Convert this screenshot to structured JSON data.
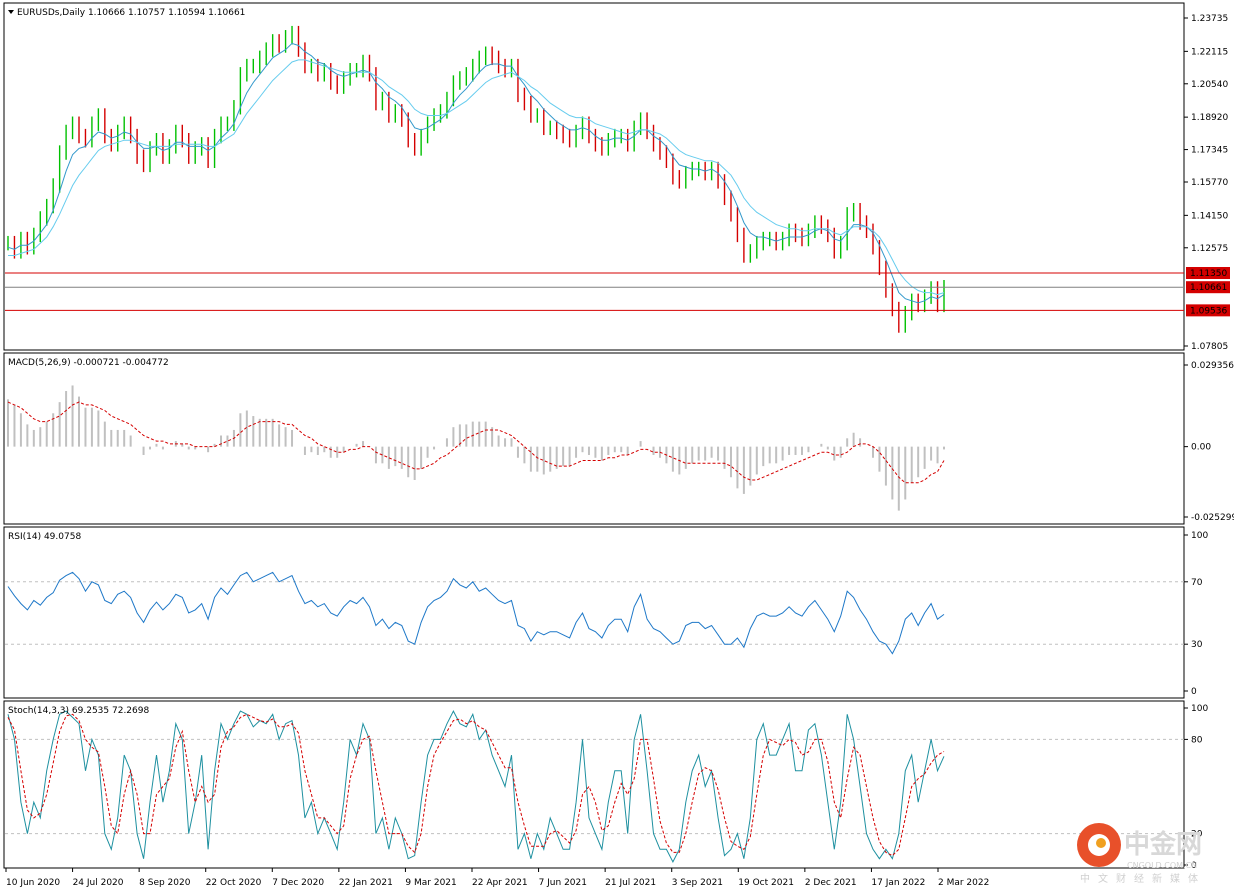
{
  "chart_data": {
    "type": "line",
    "main": {
      "header": "EURUSDs,Daily  1.10666 1.10757 1.10594 1.10661",
      "ylim": [
        1.07805,
        1.23735
      ],
      "yticks": [
        1.23735,
        1.22115,
        1.2054,
        1.1892,
        1.17345,
        1.1577,
        1.1415,
        1.12575,
        1.07805
      ],
      "ytick_labels": [
        "1.23735",
        "1.22115",
        "1.20540",
        "1.18920",
        "1.17345",
        "1.15770",
        "1.14150",
        "1.12575",
        "1.07805"
      ],
      "hlines": [
        {
          "value": 1.1135,
          "label": "1.11350",
          "color": "#d40000"
        },
        {
          "value": 1.09536,
          "label": "1.09536",
          "color": "#d40000"
        },
        {
          "value": 1.10661,
          "label": "1.10661",
          "color": "#808080"
        }
      ],
      "x_dates": [
        "10 Jun 2020",
        "24 Jul 2020",
        "8 Sep 2020",
        "22 Oct 2020",
        "7 Dec 2020",
        "22 Jan 2021",
        "9 Mar 2021",
        "22 Apr 2021",
        "7 Jun 2021",
        "21 Jul 2021",
        "3 Sep 2021",
        "19 Oct 2021",
        "2 Dec 2021",
        "17 Jan 2022",
        "2 Mar 2022"
      ],
      "close": [
        1.128,
        1.124,
        1.13,
        1.126,
        1.132,
        1.14,
        1.146,
        1.156,
        1.172,
        1.182,
        1.186,
        1.18,
        1.178,
        1.186,
        1.19,
        1.18,
        1.176,
        1.182,
        1.186,
        1.18,
        1.17,
        1.166,
        1.174,
        1.178,
        1.17,
        1.175,
        1.182,
        1.178,
        1.17,
        1.174,
        1.176,
        1.168,
        1.18,
        1.186,
        1.186,
        1.194,
        1.21,
        1.214,
        1.214,
        1.218,
        1.222,
        1.226,
        1.224,
        1.228,
        1.23,
        1.222,
        1.214,
        1.214,
        1.21,
        1.212,
        1.206,
        1.204,
        1.208,
        1.212,
        1.212,
        1.216,
        1.21,
        1.196,
        1.198,
        1.19,
        1.192,
        1.188,
        1.178,
        1.174,
        1.18,
        1.186,
        1.19,
        1.192,
        1.198,
        1.206,
        1.208,
        1.21,
        1.214,
        1.218,
        1.22,
        1.218,
        1.214,
        1.212,
        1.214,
        1.2,
        1.196,
        1.19,
        1.19,
        1.184,
        1.184,
        1.182,
        1.18,
        1.178,
        1.182,
        1.186,
        1.18,
        1.176,
        1.174,
        1.178,
        1.18,
        1.18,
        1.176,
        1.184,
        1.188,
        1.182,
        1.176,
        1.172,
        1.168,
        1.16,
        1.158,
        1.162,
        1.164,
        1.164,
        1.162,
        1.164,
        1.158,
        1.15,
        1.142,
        1.132,
        1.122,
        1.124,
        1.128,
        1.13,
        1.13,
        1.128,
        1.13,
        1.134,
        1.132,
        1.13,
        1.134,
        1.138,
        1.136,
        1.132,
        1.124,
        1.128,
        1.142,
        1.144,
        1.138,
        1.134,
        1.126,
        1.116,
        1.105,
        1.096,
        1.088,
        1.094,
        1.1,
        1.098,
        1.102,
        1.106,
        1.098,
        1.10661
      ],
      "ema_fast": [
        1.126,
        1.125,
        1.127,
        1.127,
        1.129,
        1.133,
        1.137,
        1.144,
        1.153,
        1.163,
        1.171,
        1.174,
        1.175,
        1.179,
        1.182,
        1.181,
        1.179,
        1.18,
        1.182,
        1.181,
        1.177,
        1.174,
        1.174,
        1.175,
        1.173,
        1.174,
        1.177,
        1.177,
        1.175,
        1.175,
        1.175,
        1.173,
        1.175,
        1.179,
        1.182,
        1.186,
        1.194,
        1.201,
        1.206,
        1.21,
        1.214,
        1.218,
        1.22,
        1.222,
        1.225,
        1.224,
        1.221,
        1.219,
        1.216,
        1.215,
        1.212,
        1.21,
        1.209,
        1.21,
        1.211,
        1.212,
        1.211,
        1.206,
        1.203,
        1.199,
        1.197,
        1.194,
        1.189,
        1.184,
        1.183,
        1.184,
        1.186,
        1.188,
        1.191,
        1.196,
        1.2,
        1.203,
        1.207,
        1.211,
        1.214,
        1.215,
        1.215,
        1.214,
        1.214,
        1.209,
        1.205,
        1.2,
        1.197,
        1.193,
        1.19,
        1.187,
        1.185,
        1.183,
        1.183,
        1.184,
        1.183,
        1.18,
        1.178,
        1.178,
        1.179,
        1.179,
        1.178,
        1.18,
        1.183,
        1.183,
        1.18,
        1.178,
        1.175,
        1.17,
        1.166,
        1.165,
        1.164,
        1.164,
        1.163,
        1.164,
        1.162,
        1.158,
        1.153,
        1.146,
        1.138,
        1.133,
        1.131,
        1.131,
        1.13,
        1.129,
        1.13,
        1.131,
        1.131,
        1.131,
        1.132,
        1.134,
        1.135,
        1.134,
        1.13,
        1.129,
        1.133,
        1.137,
        1.137,
        1.136,
        1.133,
        1.127,
        1.12,
        1.112,
        1.104,
        1.101,
        1.1,
        1.099,
        1.1,
        1.102,
        1.101,
        1.103
      ],
      "ema_slow": [
        1.122,
        1.122,
        1.123,
        1.124,
        1.125,
        1.128,
        1.131,
        1.136,
        1.142,
        1.149,
        1.156,
        1.161,
        1.165,
        1.169,
        1.173,
        1.175,
        1.176,
        1.177,
        1.178,
        1.178,
        1.177,
        1.176,
        1.175,
        1.175,
        1.175,
        1.175,
        1.176,
        1.176,
        1.176,
        1.176,
        1.176,
        1.175,
        1.175,
        1.177,
        1.179,
        1.181,
        1.186,
        1.191,
        1.195,
        1.199,
        1.203,
        1.207,
        1.21,
        1.213,
        1.216,
        1.217,
        1.217,
        1.216,
        1.215,
        1.214,
        1.213,
        1.212,
        1.211,
        1.211,
        1.211,
        1.211,
        1.211,
        1.209,
        1.207,
        1.204,
        1.202,
        1.2,
        1.197,
        1.193,
        1.191,
        1.19,
        1.19,
        1.19,
        1.191,
        1.193,
        1.195,
        1.197,
        1.2,
        1.203,
        1.206,
        1.208,
        1.209,
        1.21,
        1.211,
        1.209,
        1.207,
        1.204,
        1.202,
        1.199,
        1.196,
        1.194,
        1.192,
        1.19,
        1.189,
        1.189,
        1.188,
        1.186,
        1.185,
        1.184,
        1.183,
        1.182,
        1.181,
        1.182,
        1.183,
        1.183,
        1.182,
        1.181,
        1.179,
        1.176,
        1.173,
        1.171,
        1.17,
        1.169,
        1.168,
        1.168,
        1.167,
        1.164,
        1.161,
        1.156,
        1.15,
        1.146,
        1.143,
        1.141,
        1.139,
        1.137,
        1.136,
        1.135,
        1.135,
        1.134,
        1.134,
        1.135,
        1.135,
        1.135,
        1.133,
        1.132,
        1.134,
        1.136,
        1.136,
        1.136,
        1.134,
        1.131,
        1.126,
        1.12,
        1.114,
        1.11,
        1.107,
        1.105,
        1.104,
        1.104,
        1.103,
        1.104
      ]
    },
    "macd": {
      "header": "MACD(5,26,9) -0.000721 -0.004772",
      "ylim": [
        -0.025299,
        0.029356
      ],
      "yticks": [
        0.029356,
        0.0,
        -0.025299
      ],
      "ytick_labels": [
        "0.029356",
        "0.00",
        "-0.025299"
      ],
      "histogram": [
        0.017,
        0.015,
        0.012,
        0.008,
        0.006,
        0.007,
        0.009,
        0.012,
        0.016,
        0.02,
        0.022,
        0.018,
        0.014,
        0.014,
        0.013,
        0.009,
        0.006,
        0.006,
        0.006,
        0.004,
        0.0,
        -0.003,
        -0.001,
        0.001,
        -0.001,
        0.0,
        0.002,
        0.001,
        -0.001,
        -0.001,
        0.0,
        -0.002,
        0.001,
        0.004,
        0.004,
        0.006,
        0.012,
        0.013,
        0.011,
        0.01,
        0.01,
        0.01,
        0.008,
        0.007,
        0.006,
        0.0,
        -0.003,
        -0.002,
        -0.003,
        -0.002,
        -0.004,
        -0.004,
        -0.002,
        0.0,
        0.001,
        0.002,
        0.0,
        -0.006,
        -0.006,
        -0.008,
        -0.007,
        -0.008,
        -0.011,
        -0.012,
        -0.008,
        -0.004,
        -0.001,
        0.0,
        0.003,
        0.007,
        0.008,
        0.008,
        0.009,
        0.009,
        0.009,
        0.007,
        0.004,
        0.003,
        0.003,
        -0.004,
        -0.006,
        -0.009,
        -0.009,
        -0.01,
        -0.009,
        -0.008,
        -0.007,
        -0.007,
        -0.004,
        -0.002,
        -0.003,
        -0.004,
        -0.005,
        -0.003,
        -0.002,
        -0.002,
        -0.003,
        0.0,
        0.002,
        0.0,
        -0.003,
        -0.004,
        -0.006,
        -0.009,
        -0.01,
        -0.008,
        -0.006,
        -0.005,
        -0.005,
        -0.004,
        -0.005,
        -0.008,
        -0.011,
        -0.015,
        -0.017,
        -0.014,
        -0.01,
        -0.007,
        -0.006,
        -0.006,
        -0.005,
        -0.003,
        -0.003,
        -0.003,
        -0.002,
        0.0,
        0.001,
        -0.001,
        -0.005,
        -0.004,
        0.003,
        0.005,
        0.003,
        0.0,
        -0.004,
        -0.009,
        -0.014,
        -0.019,
        -0.023,
        -0.019,
        -0.013,
        -0.011,
        -0.008,
        -0.005,
        -0.006,
        -0.001
      ],
      "signal": [
        0.016,
        0.015,
        0.014,
        0.012,
        0.01,
        0.009,
        0.009,
        0.01,
        0.011,
        0.013,
        0.015,
        0.016,
        0.015,
        0.015,
        0.014,
        0.013,
        0.011,
        0.01,
        0.009,
        0.008,
        0.006,
        0.004,
        0.003,
        0.002,
        0.002,
        0.001,
        0.001,
        0.001,
        0.001,
        0.0,
        0.0,
        0.0,
        0.0,
        0.001,
        0.002,
        0.003,
        0.005,
        0.007,
        0.008,
        0.009,
        0.009,
        0.009,
        0.009,
        0.008,
        0.008,
        0.006,
        0.004,
        0.003,
        0.001,
        0.0,
        -0.001,
        -0.002,
        -0.002,
        -0.001,
        -0.001,
        0.0,
        0.0,
        -0.002,
        -0.003,
        -0.004,
        -0.005,
        -0.006,
        -0.007,
        -0.008,
        -0.008,
        -0.007,
        -0.006,
        -0.004,
        -0.003,
        -0.001,
        0.001,
        0.003,
        0.004,
        0.005,
        0.006,
        0.006,
        0.006,
        0.005,
        0.004,
        0.002,
        0.0,
        -0.002,
        -0.004,
        -0.005,
        -0.006,
        -0.007,
        -0.007,
        -0.007,
        -0.006,
        -0.005,
        -0.005,
        -0.005,
        -0.005,
        -0.004,
        -0.004,
        -0.003,
        -0.003,
        -0.002,
        -0.001,
        -0.001,
        -0.002,
        -0.002,
        -0.003,
        -0.004,
        -0.005,
        -0.006,
        -0.006,
        -0.006,
        -0.006,
        -0.006,
        -0.006,
        -0.006,
        -0.007,
        -0.009,
        -0.011,
        -0.012,
        -0.012,
        -0.011,
        -0.01,
        -0.009,
        -0.008,
        -0.007,
        -0.006,
        -0.005,
        -0.004,
        -0.003,
        -0.002,
        -0.002,
        -0.003,
        -0.003,
        -0.002,
        0.0,
        0.001,
        0.001,
        0.0,
        -0.002,
        -0.005,
        -0.008,
        -0.011,
        -0.013,
        -0.013,
        -0.013,
        -0.012,
        -0.01,
        -0.009,
        -0.005
      ]
    },
    "rsi": {
      "header": "RSI(14) 49.0758",
      "ylim": [
        0,
        100
      ],
      "yticks": [
        100,
        70,
        30,
        0
      ],
      "ytick_labels": [
        "100",
        "70",
        "30",
        "0"
      ],
      "levels": [
        70,
        30
      ],
      "values": [
        67,
        61,
        56,
        52,
        58,
        55,
        60,
        63,
        71,
        74,
        76,
        72,
        64,
        70,
        68,
        58,
        56,
        62,
        64,
        60,
        50,
        44,
        52,
        57,
        52,
        56,
        62,
        60,
        50,
        52,
        56,
        46,
        60,
        66,
        62,
        68,
        74,
        76,
        70,
        72,
        74,
        76,
        70,
        72,
        74,
        64,
        56,
        58,
        54,
        56,
        50,
        48,
        54,
        58,
        56,
        60,
        54,
        42,
        46,
        40,
        44,
        42,
        32,
        30,
        44,
        54,
        58,
        60,
        64,
        72,
        68,
        66,
        70,
        64,
        66,
        62,
        58,
        56,
        58,
        42,
        40,
        32,
        38,
        36,
        38,
        38,
        36,
        34,
        44,
        50,
        40,
        38,
        34,
        42,
        46,
        46,
        38,
        54,
        62,
        46,
        40,
        38,
        34,
        30,
        32,
        42,
        44,
        44,
        40,
        42,
        36,
        30,
        30,
        34,
        28,
        40,
        48,
        50,
        48,
        48,
        50,
        54,
        50,
        48,
        54,
        58,
        52,
        46,
        38,
        48,
        64,
        60,
        52,
        46,
        38,
        32,
        30,
        24,
        32,
        46,
        50,
        42,
        50,
        56,
        46,
        49.0758
      ]
    },
    "stoch": {
      "header": "Stoch(14,3,3) 69.2535 72.2698",
      "ylim": [
        0,
        100
      ],
      "yticks": [
        100,
        80,
        20,
        0
      ],
      "ytick_labels": [
        "100",
        "80",
        "20",
        "0"
      ],
      "levels": [
        80,
        20
      ],
      "k": [
        96,
        80,
        40,
        20,
        40,
        30,
        60,
        80,
        96,
        98,
        94,
        90,
        60,
        80,
        70,
        20,
        10,
        30,
        70,
        60,
        20,
        4,
        40,
        70,
        40,
        60,
        90,
        80,
        20,
        40,
        70,
        10,
        60,
        90,
        80,
        90,
        98,
        96,
        88,
        92,
        90,
        96,
        80,
        90,
        92,
        70,
        30,
        40,
        20,
        30,
        20,
        10,
        40,
        80,
        70,
        90,
        80,
        20,
        30,
        10,
        30,
        20,
        4,
        6,
        40,
        70,
        80,
        80,
        90,
        98,
        90,
        88,
        96,
        80,
        86,
        70,
        60,
        50,
        70,
        10,
        20,
        4,
        20,
        10,
        30,
        20,
        10,
        10,
        40,
        80,
        30,
        20,
        10,
        40,
        60,
        60,
        20,
        80,
        96,
        60,
        20,
        10,
        10,
        2,
        10,
        40,
        60,
        70,
        50,
        60,
        30,
        6,
        10,
        20,
        4,
        30,
        80,
        90,
        70,
        70,
        80,
        90,
        60,
        60,
        86,
        90,
        70,
        40,
        10,
        40,
        96,
        80,
        50,
        20,
        10,
        4,
        10,
        4,
        20,
        60,
        70,
        40,
        60,
        80,
        60,
        69.2535
      ],
      "d": [
        94,
        86,
        60,
        35,
        30,
        33,
        45,
        65,
        85,
        95,
        96,
        92,
        80,
        75,
        72,
        50,
        25,
        20,
        45,
        60,
        45,
        20,
        20,
        45,
        50,
        55,
        75,
        85,
        60,
        40,
        50,
        40,
        45,
        75,
        85,
        88,
        94,
        96,
        94,
        92,
        91,
        93,
        88,
        88,
        90,
        84,
        60,
        45,
        30,
        30,
        25,
        20,
        25,
        55,
        70,
        80,
        82,
        60,
        40,
        20,
        20,
        20,
        12,
        8,
        20,
        50,
        70,
        78,
        85,
        92,
        93,
        90,
        92,
        88,
        86,
        78,
        70,
        62,
        62,
        40,
        25,
        12,
        12,
        12,
        20,
        22,
        18,
        14,
        22,
        45,
        50,
        40,
        22,
        25,
        40,
        52,
        45,
        55,
        80,
        80,
        55,
        28,
        14,
        8,
        8,
        20,
        40,
        58,
        62,
        60,
        48,
        30,
        15,
        12,
        10,
        18,
        45,
        70,
        80,
        78,
        76,
        80,
        78,
        70,
        72,
        80,
        80,
        66,
        40,
        30,
        55,
        75,
        70,
        50,
        30,
        15,
        8,
        6,
        10,
        30,
        50,
        55,
        58,
        65,
        70,
        72.2698
      ]
    }
  },
  "watermark": {
    "name": "中金网",
    "site": "CNGOLD.COM.CN",
    "slogan": "中文财经新媒体"
  },
  "colors": {
    "bull_wick": "#00c000",
    "bear_wick": "#d40000",
    "ema": "#3399cc",
    "ema2": "#66ccee",
    "macd_hist": "#c0c0c0",
    "signal": "#d40000",
    "rsi": "#1e78c8",
    "stoch_k": "#1e90a0",
    "stoch_d": "#d40000",
    "level_line": "#d40000",
    "current_line": "#909090",
    "label_box": "#d40000",
    "current_box": "#000000"
  }
}
